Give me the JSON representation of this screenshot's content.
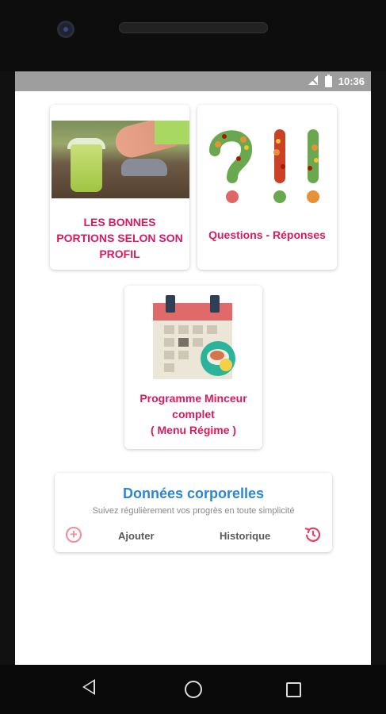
{
  "status_bar": {
    "time": "10:36"
  },
  "cards": {
    "portions": {
      "title": "LES BONNES PORTIONS SELON SON PROFIL"
    },
    "qa": {
      "title": "Questions - Réponses"
    },
    "programme": {
      "title_line1": "Programme Minceur",
      "title_line2": "complet",
      "title_line3": "( Menu Régime )"
    }
  },
  "body_data": {
    "title": "Données corporelles",
    "subtitle": "Suivez régulièrement vos progrès en toute simplicité",
    "add_label": "Ajouter",
    "history_label": "Historique"
  },
  "colors": {
    "accent_pink": "#d81b60",
    "accent_blue": "#2e86d0",
    "status_bar": "#9e9e9e"
  },
  "icons": [
    "signal-icon",
    "battery-icon",
    "plus-circle-icon",
    "history-icon",
    "back-icon",
    "home-icon",
    "recents-icon"
  ]
}
